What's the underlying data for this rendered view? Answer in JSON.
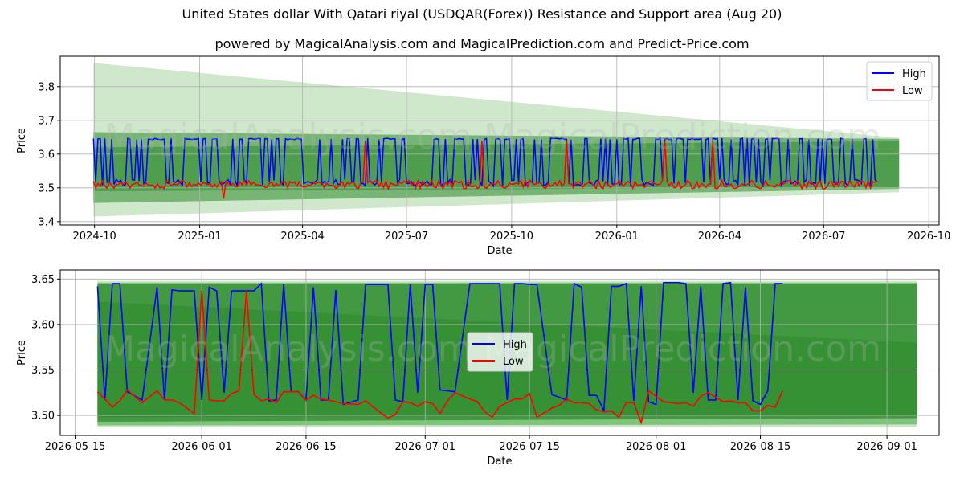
{
  "title": "United States dollar With Qatari riyal (USDQAR(Forex)) Resistance and Support area (Aug 20)",
  "subtitle": "powered by MagicalAnalysis.com and MagicalPrediction.com and Predict-Price.com",
  "watermarks": [
    "MagicalAnalysis.com",
    "MagicalPrediction.com"
  ],
  "colors": {
    "high": "#0000ff",
    "low": "#ff0000",
    "band_dark": "#2e8b2e",
    "band_light": "#a8d5a0",
    "grid": "#b0b0b0"
  },
  "chart_data": [
    {
      "type": "line",
      "xlabel": "Date",
      "ylabel": "Price",
      "ylim": [
        3.39,
        3.89
      ],
      "xlim": [
        "2024-09-01",
        "2026-10-10"
      ],
      "x_ticks": [
        "2024-10",
        "2025-01",
        "2025-04",
        "2025-07",
        "2025-10",
        "2026-01",
        "2026-04",
        "2026-07",
        "2026-10"
      ],
      "y_ticks": [
        "3.4",
        "3.5",
        "3.6",
        "3.7",
        "3.8"
      ],
      "grid": true,
      "legend": "top-right",
      "series": [
        {
          "name": "High",
          "start": "2024-09-30",
          "end": "2026-08-18",
          "description_values": {
            "upper": 3.645,
            "lower": 3.505
          }
        },
        {
          "name": "Low",
          "start": "2024-09-30",
          "end": "2026-08-18",
          "description_values": {
            "base": 3.51,
            "spikes_high": [
              3.64,
              3.64,
              3.64,
              3.55,
              3.64,
              3.64,
              3.64
            ],
            "spikes_low": [
              3.44,
              3.45,
              3.47,
              3.48
            ]
          }
        }
      ],
      "bands": {
        "start": "2024-09-30",
        "end": "2026-09-05",
        "light_start": [
          3.415,
          3.87
        ],
        "light_end": [
          3.487,
          3.648
        ],
        "dark_start": [
          3.455,
          3.665
        ],
        "dark_end": [
          3.497,
          3.645
        ]
      }
    },
    {
      "type": "line",
      "xlabel": "Date",
      "ylabel": "Price",
      "ylim": [
        3.478,
        3.66
      ],
      "xlim": [
        "2026-05-13",
        "2026-09-08"
      ],
      "x_ticks": [
        "2026-05-15",
        "2026-06-01",
        "2026-06-15",
        "2026-07-01",
        "2026-07-15",
        "2026-08-01",
        "2026-08-15",
        "2026-09-01"
      ],
      "y_ticks": [
        "3.50",
        "3.55",
        "3.60",
        "3.65"
      ],
      "grid": true,
      "legend": "center",
      "series": [
        {
          "name": "High",
          "x": [
            "2026-05-18",
            "2026-05-19",
            "2026-05-20",
            "2026-05-21",
            "2026-05-22",
            "2026-05-24",
            "2026-05-26",
            "2026-05-27",
            "2026-05-28",
            "2026-05-29",
            "2026-05-31",
            "2026-06-01",
            "2026-06-02",
            "2026-06-03",
            "2026-06-04",
            "2026-06-05",
            "2026-06-06",
            "2026-06-07",
            "2026-06-08",
            "2026-06-09",
            "2026-06-10",
            "2026-06-11",
            "2026-06-12",
            "2026-06-13",
            "2026-06-14",
            "2026-06-15",
            "2026-06-16",
            "2026-06-17",
            "2026-06-18",
            "2026-06-19",
            "2026-06-20",
            "2026-06-22",
            "2026-06-23",
            "2026-06-25",
            "2026-06-26",
            "2026-06-27",
            "2026-06-28",
            "2026-06-29",
            "2026-06-30",
            "2026-07-01",
            "2026-07-02",
            "2026-07-03",
            "2026-07-04",
            "2026-07-05",
            "2026-07-07",
            "2026-07-08",
            "2026-07-09",
            "2026-07-10",
            "2026-07-11",
            "2026-07-12",
            "2026-07-13",
            "2026-07-14",
            "2026-07-15",
            "2026-07-16",
            "2026-07-18",
            "2026-07-19",
            "2026-07-20",
            "2026-07-21",
            "2026-07-22",
            "2026-07-23",
            "2026-07-24",
            "2026-07-25",
            "2026-07-26",
            "2026-07-27",
            "2026-07-28",
            "2026-07-29",
            "2026-07-30",
            "2026-07-31",
            "2026-08-01",
            "2026-08-02",
            "2026-08-04",
            "2026-08-05",
            "2026-08-06",
            "2026-08-07",
            "2026-08-08",
            "2026-08-09",
            "2026-08-10",
            "2026-08-11",
            "2026-08-12",
            "2026-08-13",
            "2026-08-14",
            "2026-08-15",
            "2026-08-16",
            "2026-08-17",
            "2026-08-18"
          ],
          "y": [
            3.642,
            3.517,
            3.645,
            3.645,
            3.526,
            3.517,
            3.641,
            3.517,
            3.638,
            3.637,
            3.637,
            3.517,
            3.641,
            3.637,
            3.525,
            3.637,
            3.637,
            3.637,
            3.637,
            3.645,
            3.516,
            3.517,
            3.645,
            3.526,
            3.526,
            3.517,
            3.641,
            3.517,
            3.517,
            3.638,
            3.512,
            3.517,
            3.644,
            3.644,
            3.644,
            3.517,
            3.515,
            3.644,
            3.525,
            3.644,
            3.644,
            3.528,
            3.527,
            3.526,
            3.645,
            3.645,
            3.645,
            3.645,
            3.645,
            3.517,
            3.645,
            3.645,
            3.644,
            3.644,
            3.523,
            3.52,
            3.517,
            3.645,
            3.641,
            3.522,
            3.522,
            3.505,
            3.642,
            3.642,
            3.645,
            3.516,
            3.642,
            3.515,
            3.512,
            3.646,
            3.646,
            3.645,
            3.525,
            3.642,
            3.517,
            3.517,
            3.645,
            3.646,
            3.517,
            3.641,
            3.516,
            3.512,
            3.527,
            3.645,
            3.645
          ]
        },
        {
          "name": "Low",
          "x": [
            "2026-05-18",
            "2026-05-19",
            "2026-05-20",
            "2026-05-21",
            "2026-05-22",
            "2026-05-24",
            "2026-05-26",
            "2026-05-27",
            "2026-05-28",
            "2026-05-29",
            "2026-05-31",
            "2026-06-01",
            "2026-06-02",
            "2026-06-03",
            "2026-06-04",
            "2026-06-05",
            "2026-06-06",
            "2026-06-07",
            "2026-06-08",
            "2026-06-09",
            "2026-06-10",
            "2026-06-11",
            "2026-06-12",
            "2026-06-13",
            "2026-06-14",
            "2026-06-15",
            "2026-06-16",
            "2026-06-17",
            "2026-06-18",
            "2026-06-19",
            "2026-06-20",
            "2026-06-22",
            "2026-06-23",
            "2026-06-25",
            "2026-06-26",
            "2026-06-27",
            "2026-06-28",
            "2026-06-29",
            "2026-06-30",
            "2026-07-01",
            "2026-07-02",
            "2026-07-03",
            "2026-07-04",
            "2026-07-05",
            "2026-07-07",
            "2026-07-08",
            "2026-07-09",
            "2026-07-10",
            "2026-07-11",
            "2026-07-12",
            "2026-07-13",
            "2026-07-14",
            "2026-07-15",
            "2026-07-16",
            "2026-07-18",
            "2026-07-19",
            "2026-07-20",
            "2026-07-21",
            "2026-07-22",
            "2026-07-23",
            "2026-07-24",
            "2026-07-25",
            "2026-07-26",
            "2026-07-27",
            "2026-07-28",
            "2026-07-29",
            "2026-07-30",
            "2026-07-31",
            "2026-08-01",
            "2026-08-02",
            "2026-08-04",
            "2026-08-05",
            "2026-08-06",
            "2026-08-07",
            "2026-08-08",
            "2026-08-09",
            "2026-08-10",
            "2026-08-11",
            "2026-08-12",
            "2026-08-13",
            "2026-08-14",
            "2026-08-15",
            "2026-08-16",
            "2026-08-17",
            "2026-08-18"
          ],
          "y": [
            3.526,
            3.518,
            3.509,
            3.516,
            3.528,
            3.514,
            3.527,
            3.517,
            3.517,
            3.514,
            3.502,
            3.637,
            3.517,
            3.516,
            3.516,
            3.524,
            3.527,
            3.637,
            3.523,
            3.516,
            3.518,
            3.514,
            3.526,
            3.526,
            3.526,
            3.517,
            3.522,
            3.518,
            3.517,
            3.515,
            3.513,
            3.512,
            3.516,
            3.503,
            3.497,
            3.501,
            3.515,
            3.514,
            3.51,
            3.515,
            3.513,
            3.502,
            3.516,
            3.525,
            3.518,
            3.515,
            3.504,
            3.498,
            3.51,
            3.514,
            3.518,
            3.518,
            3.524,
            3.498,
            3.508,
            3.511,
            3.518,
            3.514,
            3.514,
            3.513,
            3.506,
            3.504,
            3.505,
            3.498,
            3.514,
            3.514,
            3.492,
            3.527,
            3.521,
            3.515,
            3.513,
            3.514,
            3.51,
            3.521,
            3.525,
            3.52,
            3.515,
            3.516,
            3.514,
            3.514,
            3.505,
            3.505,
            3.511,
            3.509,
            3.527
          ]
        }
      ],
      "bands": {
        "start": "2026-05-18",
        "end": "2026-09-05",
        "light": [
          [
            3.487,
            3.648
          ],
          [
            3.487,
            3.648
          ]
        ],
        "outer": [
          [
            3.489,
            3.646
          ],
          [
            3.49,
            3.646
          ]
        ],
        "dark": [
          [
            3.493,
            3.645
          ],
          [
            3.497,
            3.645
          ]
        ]
      }
    }
  ]
}
